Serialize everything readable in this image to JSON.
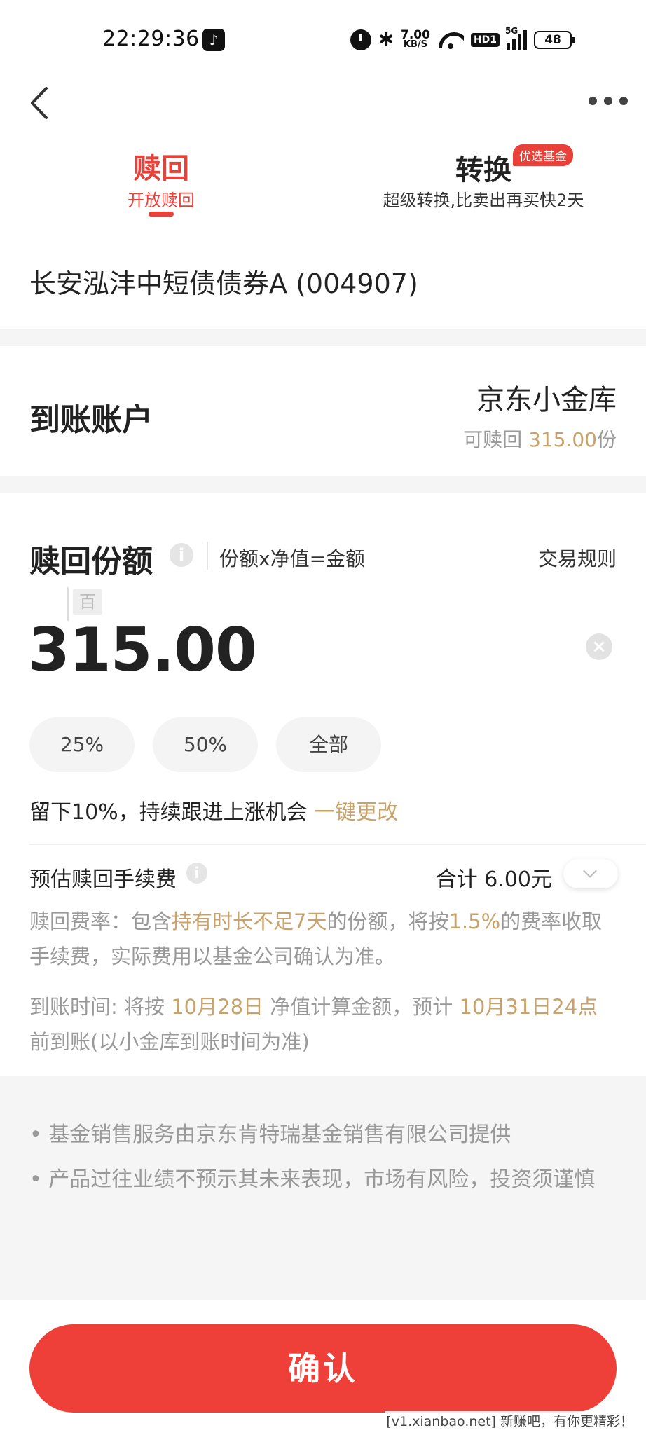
{
  "status_bar": {
    "time": "22:29:36",
    "net_speed_value": "7.00",
    "net_speed_unit": "KB/S",
    "hd_badge": "HD1",
    "signal_type": "5G",
    "battery": "48"
  },
  "nav": {
    "back_icon": "chevron-left-icon",
    "more_icon": "more-horizontal-icon"
  },
  "tabs": [
    {
      "title": "赎回",
      "subtitle": "开放赎回",
      "active": true
    },
    {
      "title": "转换",
      "subtitle": "超级转换,比卖出再买快2天",
      "badge": "优选基金",
      "active": false
    }
  ],
  "fund": {
    "name": "长安泓沣中短债债券A (004907)"
  },
  "account": {
    "label": "到账账户",
    "name": "京东小金库",
    "available_prefix": "可赎回 ",
    "available_value": "315.00",
    "available_unit": "份"
  },
  "redeem": {
    "label": "赎回份额",
    "info_icon": "i",
    "formula": "份额x净值=金额",
    "rules_link": "交易规则",
    "unit_hint": "百",
    "amount": "315.00",
    "clear_icon": "×",
    "quick_options": [
      "25%",
      "50%",
      "全部"
    ]
  },
  "keep": {
    "text": "留下10%，持续跟进上涨机会",
    "action": "一键更改"
  },
  "fee": {
    "label": "预估赎回手续费",
    "info_icon": "i",
    "total": "合计 6.00元",
    "rate_prefix": "赎回费率：包含",
    "rate_highlight1": "持有时长不足7天",
    "rate_middle": "的份额，将按",
    "rate_highlight2": "1.5%",
    "rate_suffix": "的费率收取手续费，实际费用以基金公司确认为准。",
    "arrival_prefix": "到账时间: 将按 ",
    "arrival_date1": "10月28日",
    "arrival_middle": " 净值计算金额，预计 ",
    "arrival_date2": "10月31日24点",
    "arrival_suffix": "前到账(以小金库到账时间为准)"
  },
  "notes": [
    "基金销售服务由京东肯特瑞基金销售有限公司提供",
    "产品过往业绩不预示其未来表现，市场有风险，投资须谨慎"
  ],
  "confirm_label": "确认",
  "watermark": "[v1.xianbao.net] 新赚吧，有你更精彩！",
  "colors": {
    "accent_red": "#e8413a",
    "gold": "#c8a26a"
  }
}
